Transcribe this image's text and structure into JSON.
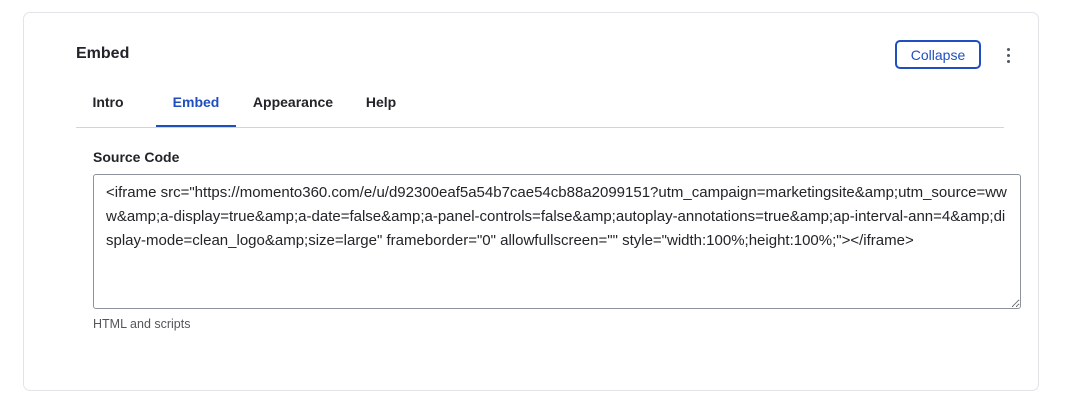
{
  "card": {
    "title": "Embed",
    "collapse_label": "Collapse"
  },
  "tabs": [
    {
      "label": "Intro",
      "active": false
    },
    {
      "label": "Embed",
      "active": true
    },
    {
      "label": "Appearance",
      "active": false
    },
    {
      "label": "Help",
      "active": false
    }
  ],
  "field": {
    "label": "Source Code",
    "value": "<iframe src=\"https://momento360.com/e/u/d92300eaf5a54b7cae54cb88a2099151?utm_campaign=marketingsite&amp;utm_source=www&amp;a-display=true&amp;a-date=false&amp;a-panel-controls=false&amp;autoplay-annotations=true&amp;ap-interval-ann=4&amp;display-mode=clean_logo&amp;size=large\" frameborder=\"0\" allowfullscreen=\"\" style=\"width:100%;height:100%;\"></iframe>",
    "help": "HTML and scripts"
  },
  "icons": {
    "drag_handle": "drag-handle-icon",
    "more": "more-vertical-icon"
  },
  "colors": {
    "accent": "#1f4fbf",
    "text": "#232429",
    "muted": "#55565b",
    "border": "#d3d4d9"
  }
}
